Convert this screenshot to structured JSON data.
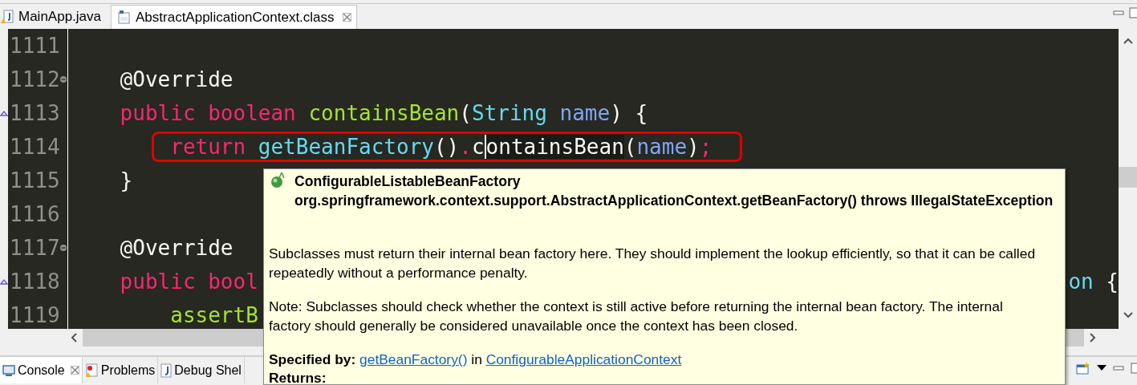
{
  "editor_tabs": [
    {
      "label": "MainApp.java",
      "selected": false,
      "kind": "java"
    },
    {
      "label": "AbstractApplicationContext.class",
      "selected": true,
      "kind": "class"
    }
  ],
  "code_lines": [
    {
      "number": "1111",
      "fold": false,
      "override": false
    },
    {
      "number": "1112",
      "fold": true,
      "override": false,
      "tokens": [
        {
          "text": "    @Override",
          "kind": "annotation"
        }
      ]
    },
    {
      "number": "1113",
      "fold": false,
      "override": true,
      "tokens": [
        {
          "text": "    public boolean ",
          "kind": "keyword"
        },
        {
          "text": "containsBean",
          "kind": "method"
        },
        {
          "text": "(",
          "kind": "plain"
        },
        {
          "text": "String ",
          "kind": "type"
        },
        {
          "text": "name",
          "kind": "param"
        },
        {
          "text": ") {",
          "kind": "plain"
        }
      ]
    },
    {
      "number": "1114",
      "fold": false,
      "override": false,
      "highlighted": true,
      "tokens": [
        {
          "text": "        return ",
          "kind": "keyword"
        },
        {
          "text": "getBeanFactory",
          "kind": "type"
        },
        {
          "text": "()",
          "kind": "plain"
        },
        {
          "text": ".",
          "kind": "keyword"
        },
        {
          "text": "c",
          "kind": "plain",
          "caret": true
        },
        {
          "text": "ontainsBean",
          "kind": "plain",
          "occurrence": true
        },
        {
          "text": "(",
          "kind": "plain"
        },
        {
          "text": "name",
          "kind": "param"
        },
        {
          "text": ")",
          "kind": "plain"
        },
        {
          "text": ";",
          "kind": "keyword"
        }
      ]
    },
    {
      "number": "1115",
      "fold": false,
      "override": false,
      "tokens": [
        {
          "text": "    }",
          "kind": "plain"
        }
      ]
    },
    {
      "number": "1116",
      "fold": false,
      "override": false
    },
    {
      "number": "1117",
      "fold": true,
      "override": false,
      "tokens": [
        {
          "text": "    @Override",
          "kind": "annotation"
        }
      ]
    },
    {
      "number": "1118",
      "fold": false,
      "override": true,
      "tokens": [
        {
          "text": "    public bool",
          "kind": "keyword"
        }
      ],
      "tail_tokens": [
        {
          "text": "on",
          "kind": "type"
        },
        {
          "text": " {",
          "kind": "plain"
        }
      ]
    },
    {
      "number": "1119",
      "fold": false,
      "override": false,
      "tokens": [
        {
          "text": "        assertB",
          "kind": "method"
        }
      ]
    }
  ],
  "hover_doc": {
    "signature": [
      "ConfigurableListableBeanFactory",
      "org.springframework.context.support.AbstractApplicationContext.getBeanFactory() throws IllegalStateException"
    ],
    "paragraphs": [
      "Subclasses must return their internal bean factory here. They should implement the lookup efficiently, so that it can be called repeatedly without a performance penalty.",
      "Note: Subclasses should check whether the context is still active before returning the internal bean factory. The internal factory should generally be considered unavailable once the context has been closed."
    ],
    "specified_by": {
      "label": "Specified by:",
      "method_link": "getBeanFactory()",
      "connector": "in",
      "class_link": "ConfigurableApplicationContext"
    },
    "returns_label": "Returns:"
  },
  "panel_tabs": [
    {
      "label": "Console",
      "selected": true,
      "kind": "console"
    },
    {
      "label": "Problems",
      "selected": false,
      "kind": "problems"
    },
    {
      "label": "Debug Shel",
      "selected": false,
      "kind": "debug"
    }
  ]
}
